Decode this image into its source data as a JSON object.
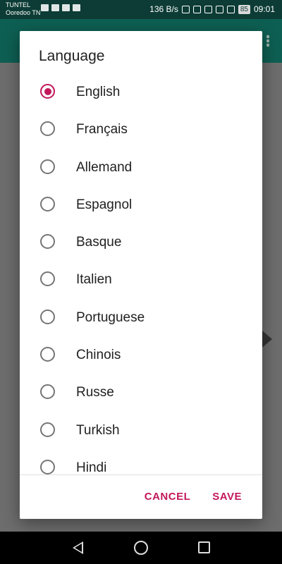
{
  "status_bar": {
    "carrier_line1": "TUNTEL",
    "carrier_line2": "Ooredoo TN",
    "network_speed": "136 B/s",
    "battery": "85",
    "time": "09:01"
  },
  "dialog": {
    "title": "Language",
    "options": [
      {
        "label": "English",
        "checked": true
      },
      {
        "label": "Français",
        "checked": false
      },
      {
        "label": "Allemand",
        "checked": false
      },
      {
        "label": "Espagnol",
        "checked": false
      },
      {
        "label": "Basque",
        "checked": false
      },
      {
        "label": "Italien",
        "checked": false
      },
      {
        "label": "Portuguese",
        "checked": false
      },
      {
        "label": "Chinois",
        "checked": false
      },
      {
        "label": "Russe",
        "checked": false
      },
      {
        "label": "Turkish",
        "checked": false
      },
      {
        "label": "Hindi",
        "checked": false
      }
    ],
    "cancel_label": "CANCEL",
    "save_label": "SAVE"
  },
  "colors": {
    "accent": "#c2185b",
    "status_bar": "#0c3c35",
    "app_bar": "#0e5f53"
  }
}
